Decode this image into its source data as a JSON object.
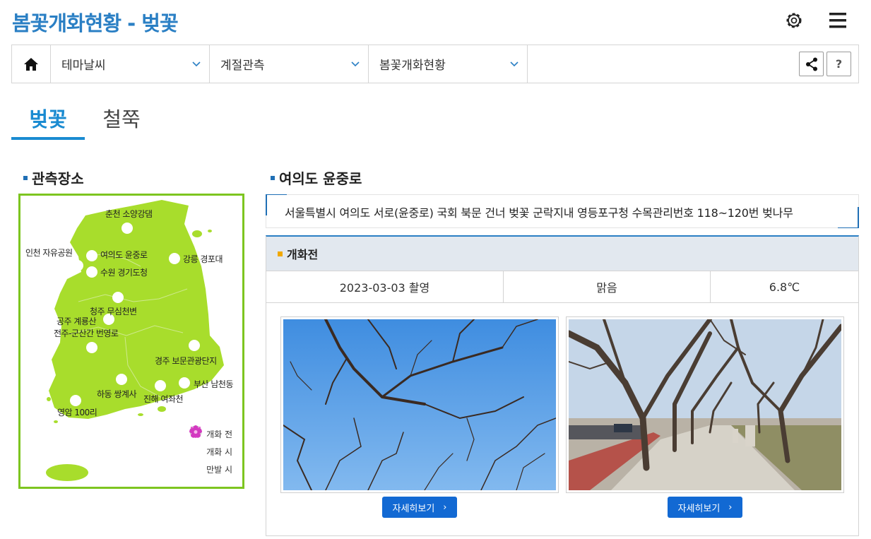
{
  "page_title": "봄꽃개화현황 - 벚꽃",
  "top_icons": [
    "gear-icon",
    "menu-icon"
  ],
  "nav": {
    "home_icon": "home-icon",
    "dropdowns": [
      {
        "label": "테마날씨"
      },
      {
        "label": "계절관측"
      },
      {
        "label": "봄꽃개화현황"
      }
    ],
    "share_icon": "share-icon",
    "help_label": "?"
  },
  "tabs": [
    {
      "label": "벚꽃",
      "active": true
    },
    {
      "label": "철쭉",
      "active": false
    }
  ],
  "sites_title": "관측장소",
  "map": {
    "sites": [
      {
        "name": "춘천 소양강댐",
        "status": "개화 전"
      },
      {
        "name": "인천 자유공원",
        "status": "개화 전"
      },
      {
        "name": "여의도 윤중로",
        "status": "개화 전"
      },
      {
        "name": "수원 경기도청",
        "status": "개화 전"
      },
      {
        "name": "강릉 경포대",
        "status": "개화 전"
      },
      {
        "name": "청주 무심천변",
        "status": "개화 전"
      },
      {
        "name": "공주 계룡산",
        "status": "개화 전"
      },
      {
        "name": "전주-군산간 번영로",
        "status": "개화 전"
      },
      {
        "name": "경주 보문관광단지",
        "status": "개화 전"
      },
      {
        "name": "부산 남천동",
        "status": "개화 전"
      },
      {
        "name": "하동 쌍계사",
        "status": "개화 전"
      },
      {
        "name": "진해 여좌천",
        "status": "개화 전"
      },
      {
        "name": "영암 100리",
        "status": "개화 전"
      }
    ],
    "legend": [
      {
        "label": "개화 전",
        "icon": "white-circle-icon"
      },
      {
        "label": "개화 시",
        "icon": "bloom-start-icon",
        "color": "#e84fd0"
      },
      {
        "label": "만발 시",
        "icon": "full-bloom-icon",
        "color": "#d33ac0"
      }
    ],
    "land_color": "#a8dd2c",
    "border_color": "#7dc520"
  },
  "location": {
    "title": "여의도 윤중로",
    "address": "서울특별시 여의도 서로(윤중로) 국회 북문 건너 벚꽃 군락지내 영등포구청 수목관리번호 118~120번 벚나무"
  },
  "status": {
    "label": "개화전",
    "date": "2023-03-03 촬영",
    "weather": "맑음",
    "temperature": "6.8℃"
  },
  "photos": [
    {
      "button_label": "자세히보기"
    },
    {
      "button_label": "자세히보기"
    }
  ],
  "colors": {
    "accent": "#2a7fc4",
    "tab_active": "#1a8bd1",
    "button": "#1269d3",
    "status_header_bg": "#e2e8ef",
    "status_marker": "#f0a800"
  }
}
